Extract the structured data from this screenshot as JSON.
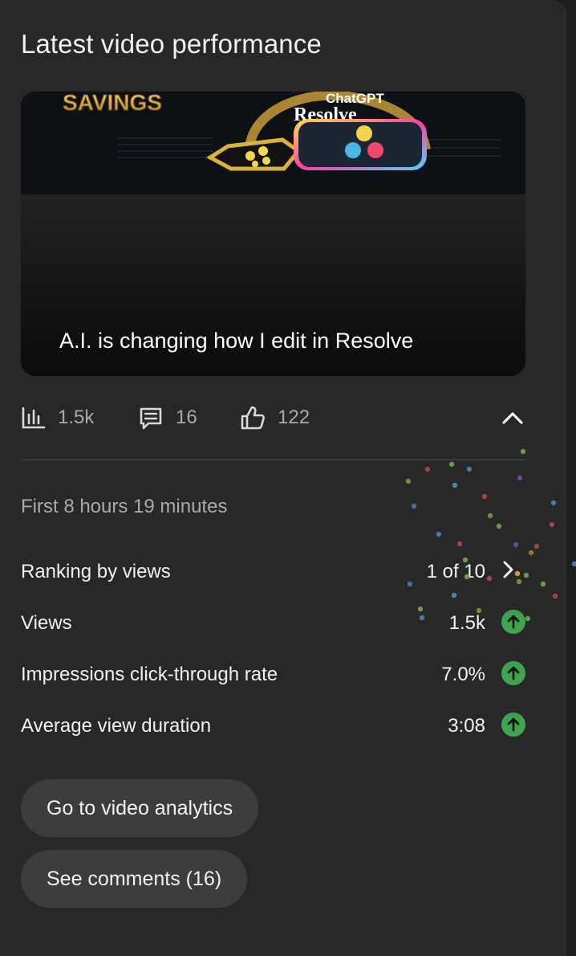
{
  "card": {
    "title": "Latest video performance"
  },
  "video": {
    "title": "A.I. is changing how I edit in Resolve",
    "thumbnail_text": {
      "left": "SAVINGS",
      "top": "ChatGPT",
      "bottom": "Resolve"
    }
  },
  "stats": {
    "views": "1.5k",
    "comments": "16",
    "likes": "122"
  },
  "period": "First 8 hours 19 minutes",
  "metrics": [
    {
      "label": "Ranking by views",
      "value": "1 of 10"
    },
    {
      "label": "Views",
      "value": "1.5k"
    },
    {
      "label": "Impressions click-through rate",
      "value": "7.0%"
    },
    {
      "label": "Average view duration",
      "value": "3:08"
    }
  ],
  "buttons": {
    "analytics": "Go to video analytics",
    "comments": "See comments (16)"
  },
  "colors": {
    "card_bg": "#282828",
    "trend_up": "#3ea44f",
    "muted_text": "#aaaaaa"
  }
}
